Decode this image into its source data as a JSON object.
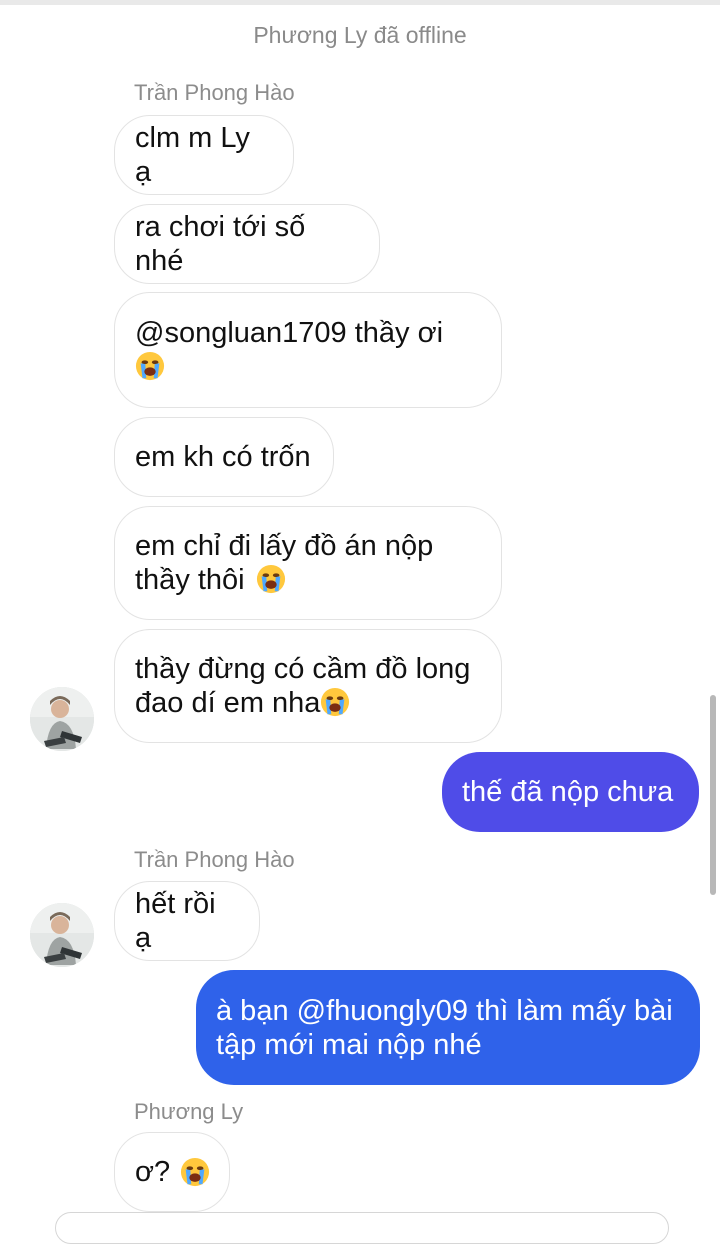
{
  "status_text": "Phương Ly đã offline",
  "groups": [
    {
      "sender": "Trần Phong Hào",
      "messages": [
        {
          "text": "clm m Ly ạ",
          "emoji": false
        },
        {
          "text": "ra chơi tới số nhé",
          "emoji": false
        },
        {
          "text": "@songluan1709 thầy ơi",
          "emoji": true
        },
        {
          "text": "em kh có trốn",
          "emoji": false
        },
        {
          "line1": "em chỉ đi lấy đồ án nộp",
          "line2": "thầy thôi",
          "emoji": true
        },
        {
          "line1": "thầy đừng có cầm đồ long",
          "line2": "đao dí em nha",
          "emoji": true
        }
      ]
    },
    {
      "sender": "Trần Phong Hào",
      "messages": [
        {
          "text": "hết rồi ạ",
          "emoji": false
        }
      ]
    },
    {
      "sender": "Phương Ly",
      "messages": [
        {
          "text": "ơ?",
          "emoji": true
        }
      ]
    }
  ],
  "outgoing": [
    {
      "text": "thế đã nộp chưa"
    },
    {
      "line1": "à bạn @fhuongly09 thì làm mấy bài",
      "line2": "tập mới mai nộp nhé"
    }
  ],
  "colors": {
    "outgoing_top": "#5b49e8",
    "outgoing_bottom": "#2563eb",
    "incoming_border": "#e3e3e3"
  },
  "icons": {
    "emoji": "loudly-crying-face-icon",
    "avatar": "user-avatar"
  }
}
